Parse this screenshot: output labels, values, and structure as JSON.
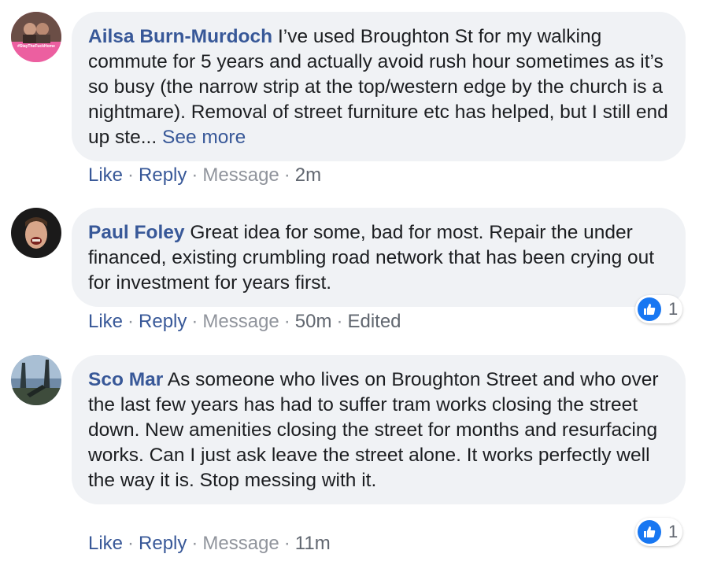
{
  "comments": [
    {
      "author": "Ailsa Burn-Murdoch",
      "text": "I’ve used Broughton St for my walking commute for 5 years and actually avoid rush hour sometimes as it’s so busy (the narrow strip at the top/western edge by the church is a nightmare). Removal of street furniture etc has helped, but I still end up ste...",
      "see_more": "See more",
      "avatar_badge_text": "#StayTheFuckHome",
      "actions": {
        "like": "Like",
        "reply": "Reply",
        "message": "Message",
        "time": "2m"
      }
    },
    {
      "author": "Paul Foley",
      "text": "Great idea for some, bad for most. Repair the under financed, existing crumbling road network that has been crying out for investment for years first.",
      "actions": {
        "like": "Like",
        "reply": "Reply",
        "message": "Message",
        "time": "50m",
        "edited": "Edited"
      },
      "reactions": {
        "icon": "like-icon",
        "count": "1"
      }
    },
    {
      "author": "Sco Mar",
      "text": "As someone who lives on Broughton Street and who over the last few years has had to suffer tram works closing the street down. New amenities closing the street for months and resurfacing works. Can I just ask leave the street alone. It works perfectly well the way it is. Stop messing with it.",
      "actions": {
        "like": "Like",
        "reply": "Reply",
        "message": "Message",
        "time": "11m"
      },
      "reactions": {
        "icon": "like-icon",
        "count": "1"
      }
    }
  ],
  "colors": {
    "link": "#385898",
    "bubble": "#f0f2f5",
    "muted": "#90949c",
    "like_blue": "#1877f2"
  }
}
